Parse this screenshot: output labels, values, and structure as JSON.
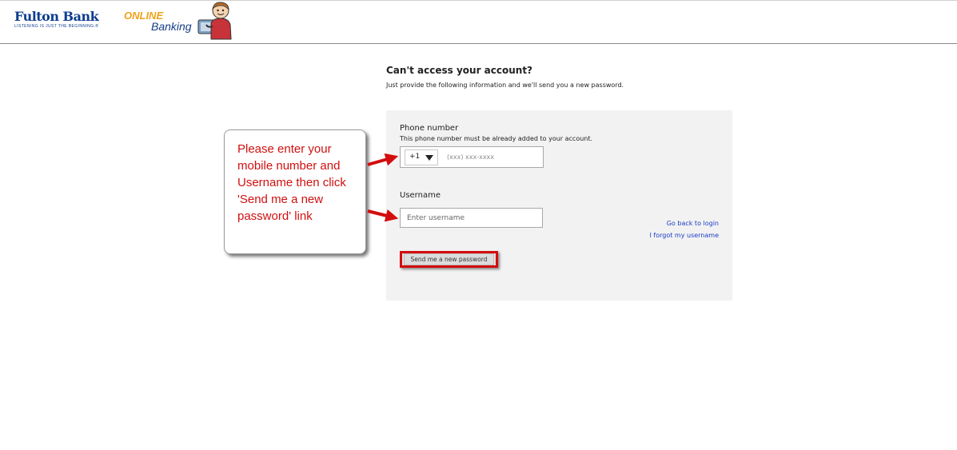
{
  "header": {
    "brand_name": "Fulton Bank",
    "brand_tagline": "LISTENING IS JUST THE BEGINNING.®",
    "online_label": "ONLINE",
    "banking_label": "Banking"
  },
  "page": {
    "title": "Can't access your account?",
    "subtitle": "Just provide the following information and we'll send you a new password."
  },
  "form": {
    "phone_label": "Phone number",
    "phone_hint": "This phone number must be already added to your account.",
    "country_code": "+1",
    "phone_placeholder": "(xxx) xxx-xxxx",
    "username_label": "Username",
    "username_placeholder": "Enter username",
    "back_link": "Go back to login",
    "forgot_username_link": "I forgot my username",
    "submit_label": "Send me a new password"
  },
  "annotation": {
    "callout_text": "Please enter your mobile number and Username then click 'Send me a new password' link"
  },
  "colors": {
    "brand_blue": "#0d3d8f",
    "online_orange": "#f0a21b",
    "link_blue": "#1a3cc8",
    "annotation_red": "#d30d0d",
    "panel_gray": "#f2f2f2"
  }
}
